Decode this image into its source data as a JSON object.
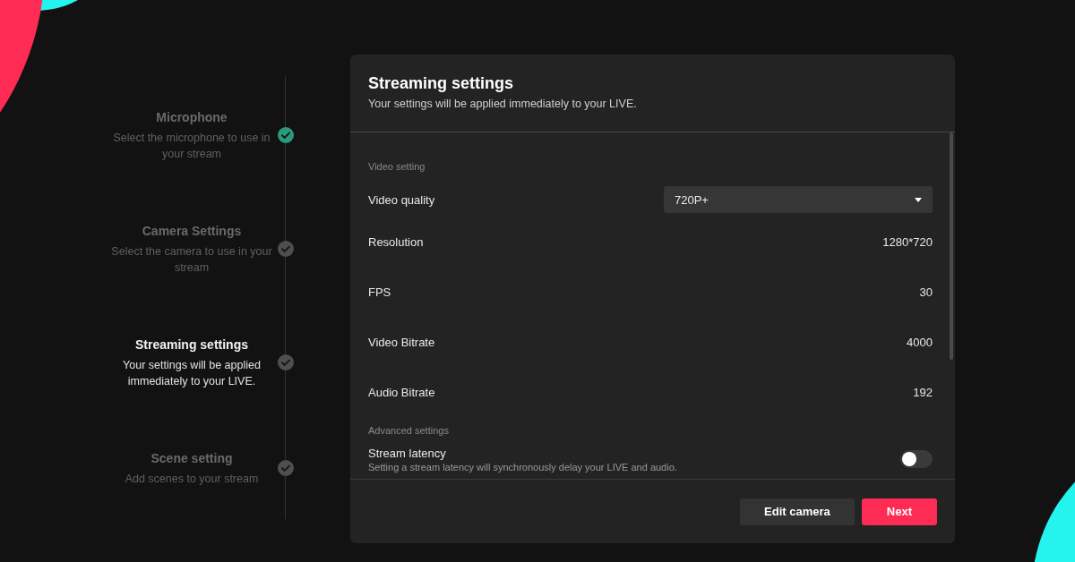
{
  "steps": [
    {
      "title": "Microphone",
      "description": "Select the microphone to use in your stream",
      "selected": false,
      "completed": true
    },
    {
      "title": "Camera Settings",
      "description": "Select the camera to use in your stream",
      "selected": false,
      "completed": false
    },
    {
      "title": "Streaming settings",
      "description": "Your settings will be applied immediately to your LIVE.",
      "selected": true,
      "completed": false
    },
    {
      "title": "Scene setting",
      "description": "Add scenes to your stream",
      "selected": false,
      "completed": false
    }
  ],
  "panel": {
    "title": "Streaming settings",
    "subtitle": "Your settings will be applied immediately to your LIVE."
  },
  "settings": [
    {
      "kind": "heading",
      "label": "Video setting"
    },
    {
      "kind": "select",
      "label": "Video quality",
      "value": "720P+"
    },
    {
      "kind": "value",
      "label": "Resolution",
      "value": "1280*720"
    },
    {
      "kind": "value",
      "label": "FPS",
      "value": "30"
    },
    {
      "kind": "value",
      "label": "Video Bitrate",
      "value": "4000"
    },
    {
      "kind": "value",
      "label": "Audio Bitrate",
      "value": "192"
    },
    {
      "kind": "heading",
      "label": "Advanced settings"
    },
    {
      "kind": "toggle",
      "label": "Stream latency",
      "description": "Setting a stream latency will synchronously delay your LIVE and audio.",
      "on": false
    }
  ],
  "buttons": [
    {
      "label": "Edit camera",
      "kind": "secondary"
    },
    {
      "label": "Next",
      "kind": "primary"
    }
  ]
}
